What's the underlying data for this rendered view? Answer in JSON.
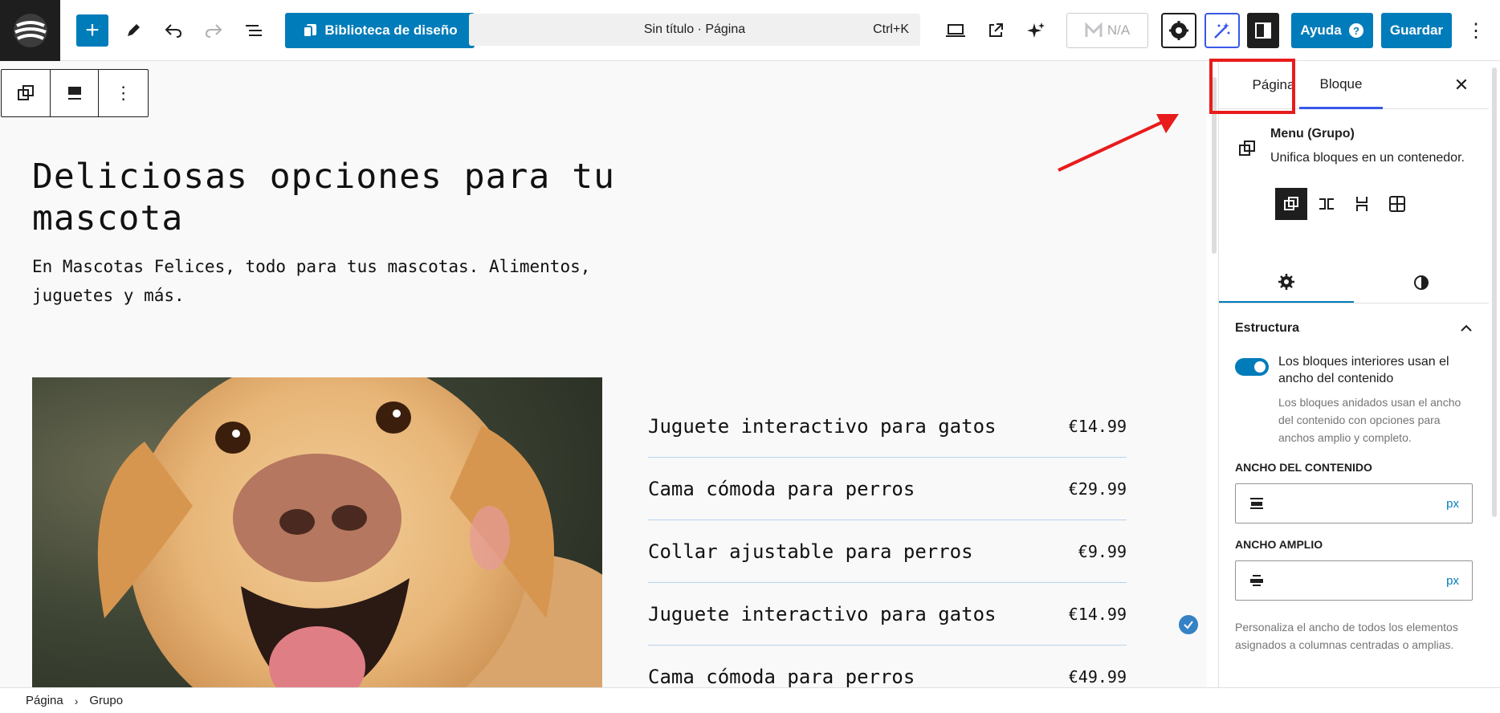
{
  "toolbar": {
    "library_label": "Biblioteca de diseño",
    "doc_title": "Sin título · Página",
    "shortcut": "Ctrl+K",
    "na_label": "N/A",
    "help_label": "Ayuda",
    "save_label": "Guardar"
  },
  "canvas": {
    "title": "Deliciosas opciones para tu mascota",
    "subtitle": "En Mascotas Felices, todo para tus mascotas. Alimentos, juguetes y más.",
    "menu": [
      {
        "name": "Juguete interactivo para gatos",
        "price": "€14.99"
      },
      {
        "name": "Cama cómoda para perros",
        "price": "€29.99"
      },
      {
        "name": "Collar ajustable para perros",
        "price": "€9.99"
      },
      {
        "name": "Juguete interactivo para gatos",
        "price": "€14.99"
      },
      {
        "name": "Cama cómoda para perros",
        "price": "€49.99"
      }
    ]
  },
  "breadcrumb": {
    "items": [
      "Página",
      "Grupo"
    ]
  },
  "sidebar": {
    "tabs": {
      "page": "Página",
      "block": "Bloque"
    },
    "block_name": "Menu (Grupo)",
    "block_desc": "Unifica bloques en un contenedor.",
    "panel_title": "Estructura",
    "toggle_label": "Los bloques interiores usan el ancho del contenido",
    "toggle_help": "Los bloques anidados usan el ancho del contenido con opciones para anchos amplio y completo.",
    "content_width_label": "ANCHO DEL CONTENIDO",
    "wide_width_label": "ANCHO AMPLIO",
    "unit": "px",
    "footer_help": "Personaliza el ancho de todos los elementos asignados a columnas centradas o amplias."
  },
  "colors": {
    "accent": "#007cba",
    "highlight": "#e81c1c"
  },
  "icons": [
    "wordpress-logo-icon",
    "plus-icon",
    "pencil-icon",
    "undo-icon",
    "redo-icon",
    "list-view-icon",
    "desktop-icon",
    "external-link-icon",
    "sparkle-icon",
    "gear-icon",
    "magic-wand-icon",
    "sidebar-icon",
    "help-icon",
    "more-vertical-icon",
    "group-icon",
    "align-icon",
    "close-icon",
    "chevron-up-icon",
    "contrast-icon",
    "check-icon"
  ]
}
